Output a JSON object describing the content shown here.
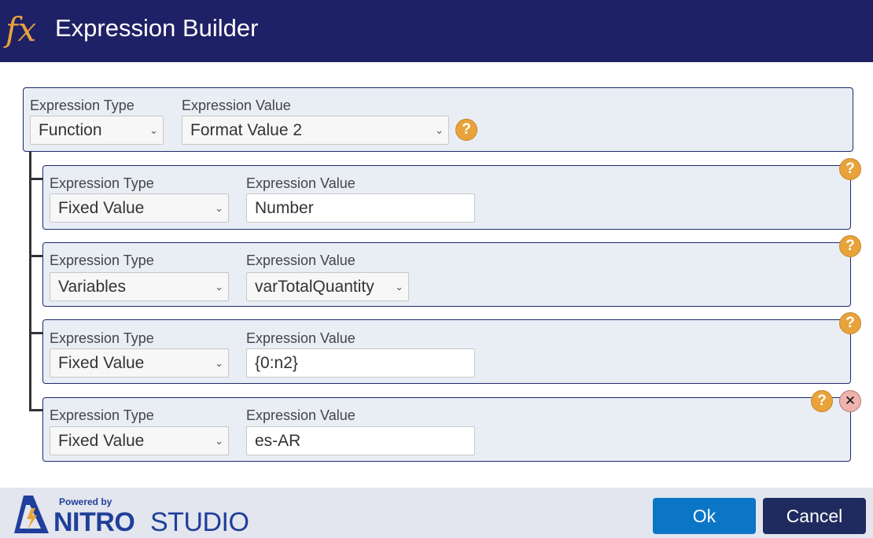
{
  "header": {
    "fx_glyph": "fx",
    "title": "Expression Builder"
  },
  "labels": {
    "type": "Expression Type",
    "value": "Expression Value"
  },
  "root": {
    "type": "Function",
    "value": "Format Value 2"
  },
  "params": [
    {
      "type": "Fixed Value",
      "value": "Number",
      "value_kind": "input"
    },
    {
      "type": "Variables",
      "value": "varTotalQuantity",
      "value_kind": "select"
    },
    {
      "type": "Fixed Value",
      "value": "{0:n2}",
      "value_kind": "input"
    },
    {
      "type": "Fixed Value",
      "value": "es-AR",
      "value_kind": "input"
    }
  ],
  "icons": {
    "help": "?",
    "close": "✕",
    "chevron": "⌄"
  },
  "footer": {
    "powered_by": "Powered by",
    "brand_bold": "NITRO",
    "brand_light": "STUDIO",
    "ok_label": "Ok",
    "cancel_label": "Cancel"
  },
  "colors": {
    "header_bg": "#1f2166",
    "accent": "#e8a33a",
    "ok": "#0b75c6",
    "cancel": "#1f2a5e"
  }
}
